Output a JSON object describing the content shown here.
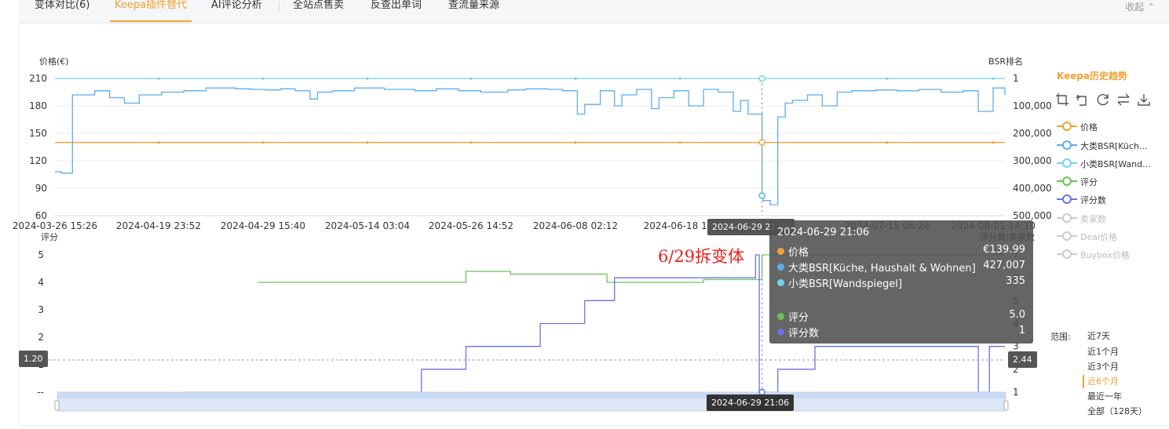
{
  "tabs": [
    {
      "label": "变体对比(6)"
    },
    {
      "label": "Keepa插件替代"
    },
    {
      "label": "AI评论分析"
    },
    {
      "label": "全站点售卖"
    },
    {
      "label": "反查出单词"
    },
    {
      "label": "查流量来源"
    }
  ],
  "active_tab": "Keepa插件替代",
  "collapse_label": "收起",
  "legend": {
    "title": "Keepa历史趋势",
    "items": [
      {
        "label": "价格",
        "color": "#f0a133",
        "on": true
      },
      {
        "label": "大类BSR[Küch...",
        "color": "#5aaef0",
        "on": true
      },
      {
        "label": "小类BSR[Wand...",
        "color": "#6fd3ef",
        "on": true
      },
      {
        "label": "评分",
        "color": "#6cc25a",
        "on": true
      },
      {
        "label": "评分数",
        "color": "#6873e0",
        "on": true
      },
      {
        "label": "卖家数",
        "color": "#cccccc",
        "on": false
      },
      {
        "label": "Deal价格",
        "color": "#cccccc",
        "on": false
      },
      {
        "label": "Buybox价格",
        "color": "#cccccc",
        "on": false
      }
    ]
  },
  "toolbox_icons": [
    "crop-icon",
    "undo-icon",
    "refresh-icon",
    "swap-icon",
    "download-icon"
  ],
  "range": {
    "label": "范围:",
    "options": [
      "近7天",
      "近1个月",
      "近3个月",
      "近6个月",
      "最近一年",
      "全部（128天）"
    ],
    "active": "近6个月"
  },
  "tooltip": {
    "title": "2024-06-29 21:06",
    "rows": [
      {
        "name": "价格",
        "value": "€139.99",
        "color": "#f0a133"
      },
      {
        "name": "大类BSR[Küche, Haushalt & Wohnen]",
        "value": "427,007",
        "color": "#5aaef0"
      },
      {
        "name": "小类BSR[Wandspiegel]",
        "value": "335",
        "color": "#6fd3ef"
      },
      {
        "name": "评分",
        "value": "5.0",
        "color": "#6cc25a"
      },
      {
        "name": "评分数",
        "value": "1",
        "color": "#6873e0"
      }
    ]
  },
  "annotation": "6/29拆变体",
  "pointer": {
    "x_label": "2024-06-29 21:06",
    "left_value": "1.20",
    "right_value": "2.44"
  },
  "chart_data": [
    {
      "type": "line",
      "panel": "top",
      "ylabel_left": "价格(€)",
      "ylabel_right": "BSR排名",
      "ylim_left": [
        60,
        210
      ],
      "yticks_left": [
        210,
        180,
        150,
        120,
        90,
        60
      ],
      "ylim_right": [
        500000,
        1
      ],
      "yticks_right": [
        "1",
        "100,000",
        "200,000",
        "300,000",
        "400,000",
        "500,000"
      ],
      "xlim": [
        "2024-03-26 15:26",
        "2024-08-01 14:10"
      ],
      "xticks": [
        "2024-03-26 15:26",
        "2024-04-19 23:52",
        "2024-04-29 15:40",
        "2024-05-14 03:04",
        "2024-05-26 14:52",
        "2024-06-08 02:12",
        "2024-06-18 17:",
        "2024-06-29 21:06",
        "2024-07-15 06:28",
        "2024-08-01 14:10"
      ],
      "series": [
        {
          "name": "价格",
          "color": "#f0a133",
          "axis": "left",
          "points": [
            [
              "2024-03-26 15:26",
              139.99
            ],
            [
              "2024-08-01 14:10",
              139.99
            ]
          ]
        },
        {
          "name": "大类BSR[Küche, Haushalt & Wohnen]",
          "color": "#5aaef0",
          "axis": "right",
          "step": true,
          "points": [
            [
              "2024-03-26 15:26",
              340000
            ],
            [
              "2024-03-27 12:00",
              345000
            ],
            [
              "2024-03-29 00:00",
              60000
            ],
            [
              "2024-04-01 00:00",
              45000
            ],
            [
              "2024-04-03 00:00",
              70000
            ],
            [
              "2024-04-05 00:00",
              90000
            ],
            [
              "2024-04-07 00:00",
              60000
            ],
            [
              "2024-04-10 00:00",
              50000
            ],
            [
              "2024-04-13 00:00",
              45000
            ],
            [
              "2024-04-16 00:00",
              35000
            ],
            [
              "2024-04-19 23:52",
              38000
            ],
            [
              "2024-04-22 00:00",
              40000
            ],
            [
              "2024-04-24 00:00",
              42000
            ],
            [
              "2024-04-26 00:00",
              38000
            ],
            [
              "2024-04-28 00:00",
              45000
            ],
            [
              "2024-04-30 00:00",
              75000
            ],
            [
              "2024-05-01 00:00",
              50000
            ],
            [
              "2024-05-03 00:00",
              45000
            ],
            [
              "2024-05-06 00:00",
              35000
            ],
            [
              "2024-05-10 00:00",
              40000
            ],
            [
              "2024-05-14 03:04",
              45000
            ],
            [
              "2024-05-17 00:00",
              38000
            ],
            [
              "2024-05-20 00:00",
              45000
            ],
            [
              "2024-05-23 00:00",
              50000
            ],
            [
              "2024-05-26 14:52",
              42000
            ],
            [
              "2024-05-29 00:00",
              38000
            ],
            [
              "2024-06-01 00:00",
              40000
            ],
            [
              "2024-06-03 00:00",
              45000
            ],
            [
              "2024-06-05 00:00",
              130000
            ],
            [
              "2024-06-06 00:00",
              95000
            ],
            [
              "2024-06-08 02:12",
              45000
            ],
            [
              "2024-06-10 00:00",
              100000
            ],
            [
              "2024-06-11 00:00",
              60000
            ],
            [
              "2024-06-13 00:00",
              40000
            ],
            [
              "2024-06-15 00:00",
              110000
            ],
            [
              "2024-06-16 00:00",
              70000
            ],
            [
              "2024-06-18 00:00",
              45000
            ],
            [
              "2024-06-20 00:00",
              100000
            ],
            [
              "2024-06-22 00:00",
              40000
            ],
            [
              "2024-06-24 00:00",
              50000
            ],
            [
              "2024-06-26 00:00",
              120000
            ],
            [
              "2024-06-27 00:00",
              80000
            ],
            [
              "2024-06-28 00:00",
              130000
            ],
            [
              "2024-06-29 21:06",
              427007
            ],
            [
              "2024-06-30 00:00",
              445000
            ],
            [
              "2024-07-01 00:00",
              460000
            ],
            [
              "2024-07-02 00:00",
              140000
            ],
            [
              "2024-07-03 00:00",
              90000
            ],
            [
              "2024-07-04 00:00",
              80000
            ],
            [
              "2024-07-06 00:00",
              60000
            ],
            [
              "2024-07-08 00:00",
              100000
            ],
            [
              "2024-07-10 00:00",
              50000
            ],
            [
              "2024-07-12 00:00",
              45000
            ],
            [
              "2024-07-15 06:28",
              42000
            ],
            [
              "2024-07-18 00:00",
              45000
            ],
            [
              "2024-07-21 00:00",
              40000
            ],
            [
              "2024-07-24 00:00",
              50000
            ],
            [
              "2024-07-27 00:00",
              45000
            ],
            [
              "2024-07-29 00:00",
              120000
            ],
            [
              "2024-07-31 00:00",
              35000
            ],
            [
              "2024-08-01 14:10",
              60000
            ]
          ]
        },
        {
          "name": "小类BSR[Wandspiegel]",
          "color": "#6fd3ef",
          "axis": "right",
          "points": [
            [
              "2024-03-26 15:26",
              335
            ],
            [
              "2024-08-01 14:10",
              335
            ]
          ]
        }
      ]
    },
    {
      "type": "line",
      "panel": "bottom",
      "ylabel_left": "评分",
      "ylabel_right": "评分数/卖家数",
      "ylim_left": [
        0,
        5
      ],
      "yticks_left": [
        "5",
        "4",
        "3",
        "2",
        "1",
        "--"
      ],
      "ylim_right": [
        1,
        7
      ],
      "yticks_right": [
        "1",
        "2",
        "3",
        "4",
        "5",
        "6",
        "7"
      ],
      "series": [
        {
          "name": "评分",
          "color": "#6cc25a",
          "axis": "left",
          "step": true,
          "points": [
            [
              "2024-04-23 00:00",
              4.0
            ],
            [
              "2024-05-21 00:00",
              4.0
            ],
            [
              "2024-05-21 00:01",
              4.4
            ],
            [
              "2024-05-27 00:00",
              4.4
            ],
            [
              "2024-05-27 00:01",
              4.3
            ],
            [
              "2024-06-09 00:00",
              4.3
            ],
            [
              "2024-06-09 00:01",
              4.0
            ],
            [
              "2024-06-22 00:00",
              4.0
            ],
            [
              "2024-06-22 00:01",
              4.1
            ],
            [
              "2024-06-29 00:00",
              4.1
            ],
            [
              "2024-06-29 21:06",
              5.0
            ],
            [
              "2024-08-01 14:10",
              5.0
            ]
          ]
        },
        {
          "name": "评分数",
          "color": "#6873e0",
          "axis": "right",
          "step": true,
          "points": [
            [
              "2024-04-13 00:00",
              1
            ],
            [
              "2024-05-15 00:00",
              1
            ],
            [
              "2024-05-15 00:01",
              2
            ],
            [
              "2024-05-21 00:00",
              2
            ],
            [
              "2024-05-21 00:01",
              3
            ],
            [
              "2024-05-31 00:00",
              3
            ],
            [
              "2024-05-31 00:01",
              4
            ],
            [
              "2024-06-06 00:00",
              4
            ],
            [
              "2024-06-06 00:01",
              5
            ],
            [
              "2024-06-10 00:00",
              5
            ],
            [
              "2024-06-10 00:01",
              6
            ],
            [
              "2024-06-29 00:00",
              6
            ],
            [
              "2024-06-29 00:01",
              7
            ],
            [
              "2024-06-29 12:00",
              7
            ],
            [
              "2024-06-29 12:01",
              1
            ],
            [
              "2024-07-02 00:00",
              1
            ],
            [
              "2024-07-02 00:01",
              2
            ],
            [
              "2024-07-07 00:00",
              2
            ],
            [
              "2024-07-07 00:01",
              3
            ],
            [
              "2024-07-29 00:00",
              3
            ],
            [
              "2024-07-29 00:01",
              1
            ],
            [
              "2024-07-30 12:00",
              1
            ],
            [
              "2024-07-30 12:01",
              3
            ],
            [
              "2024-08-01 14:10",
              3
            ]
          ]
        }
      ]
    }
  ]
}
